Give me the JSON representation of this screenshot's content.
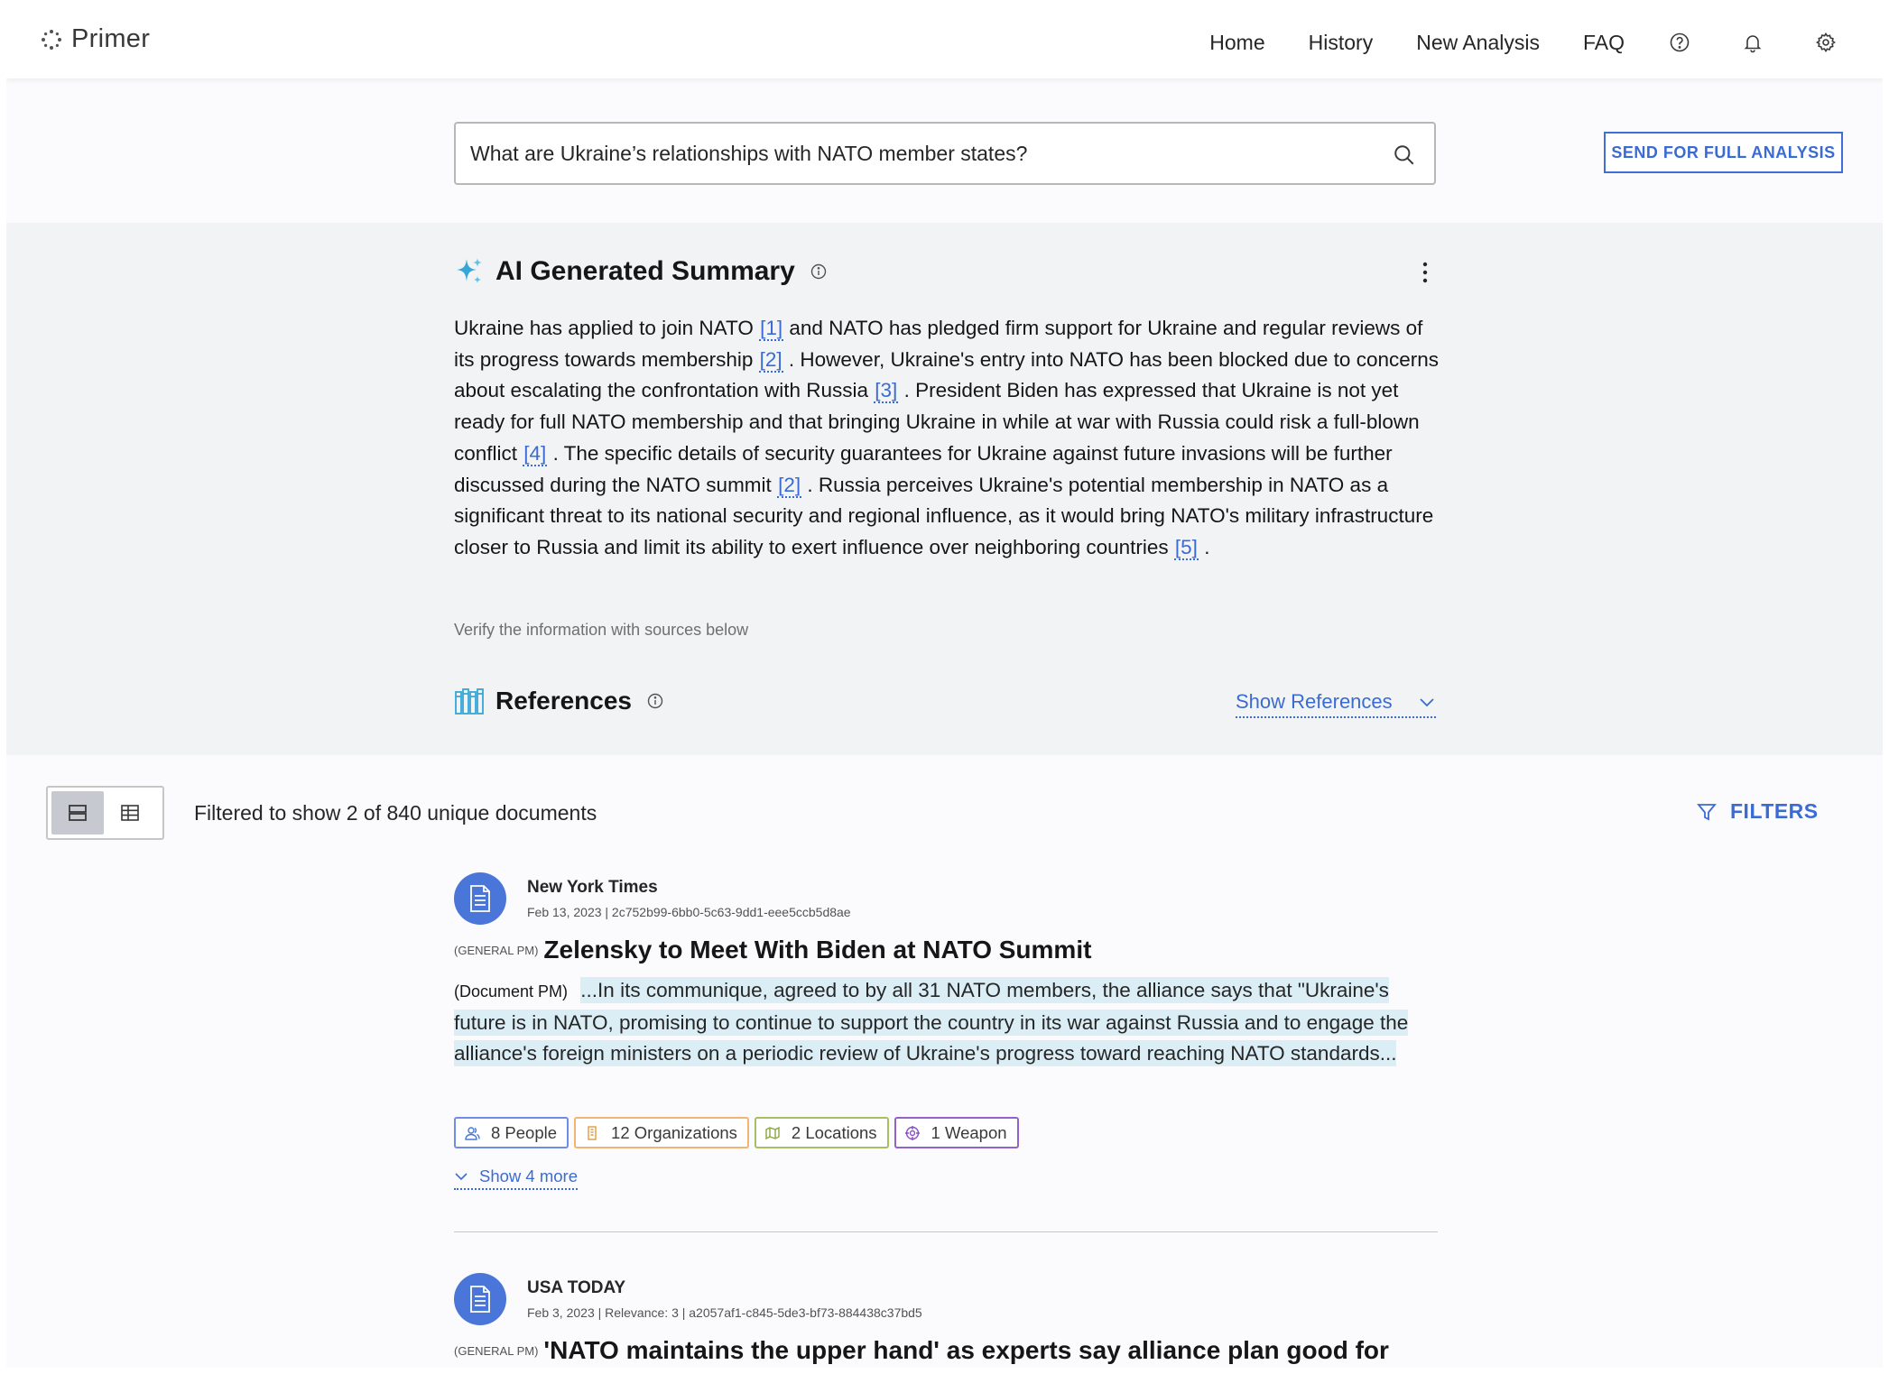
{
  "app": {
    "name": "Primer"
  },
  "nav": {
    "home": "Home",
    "history": "History",
    "new_analysis": "New Analysis",
    "faq": "FAQ"
  },
  "search": {
    "value": "What are Ukraine’s relationships with NATO member states?"
  },
  "send_button": "SEND FOR FULL ANALYSIS",
  "summary": {
    "title": "AI Generated Summary",
    "segments": [
      "Ukraine has applied to join NATO ",
      "[1]",
      " and NATO has pledged firm support for Ukraine and regular reviews of its progress towards membership ",
      "[2]",
      " . However, Ukraine's entry into NATO has been blocked due to concerns about escalating the confrontation with Russia ",
      "[3]",
      " . President Biden has expressed that Ukraine is not yet ready for full NATO membership and that bringing Ukraine in while at war with Russia could risk a full-blown conflict ",
      "[4]",
      " . The specific details of security guarantees for Ukraine against future invasions will be further discussed during the NATO summit ",
      "[2]",
      " . Russia perceives Ukraine's potential membership in NATO as a significant threat to its national security and regional influence, as it would bring NATO's military infrastructure closer to Russia and limit its ability to exert influence over neighboring countries ",
      "[5]",
      " ."
    ],
    "verify_note": "Verify the information with sources below"
  },
  "references": {
    "title": "References",
    "toggle_label": "Show References"
  },
  "results": {
    "filtered_text": "Filtered to show 2 of 840 unique documents",
    "filters_label": "FILTERS",
    "documents": [
      {
        "source": "New York Times",
        "meta": "Feb 13, 2023  |  2c752b99-6bb0-5c63-9dd1-eee5ccb5d8ae",
        "classification": "(GENERAL PM)",
        "title": "Zelensky to Meet With Biden at NATO Summit",
        "snippet_class": "(Document PM)",
        "snippet": "...In its communique, agreed to by all 31 NATO members, the alliance says that \"Ukraine's future is in NATO, promising to continue to support the country in its war against Russia and to engage the alliance's foreign ministers on a periodic review of Ukraine's progress toward reaching NATO standards...",
        "tags": {
          "people": "8 People",
          "orgs": "12 Organizations",
          "locations": "2 Locations",
          "weapons": "1 Weapon"
        },
        "show_more": "Show 4 more"
      },
      {
        "source": "USA TODAY",
        "meta": "Feb 3, 2023  |  Relevance: 3  |  a2057af1-c845-5de3-bf73-884438c37bd5",
        "classification": "(GENERAL PM)",
        "title": "'NATO maintains the upper hand' as experts say alliance plan good for"
      }
    ]
  },
  "colors": {
    "accent": "#3a6bd3",
    "panel": "#f2f3f5",
    "highlight": "#dbeef6"
  }
}
